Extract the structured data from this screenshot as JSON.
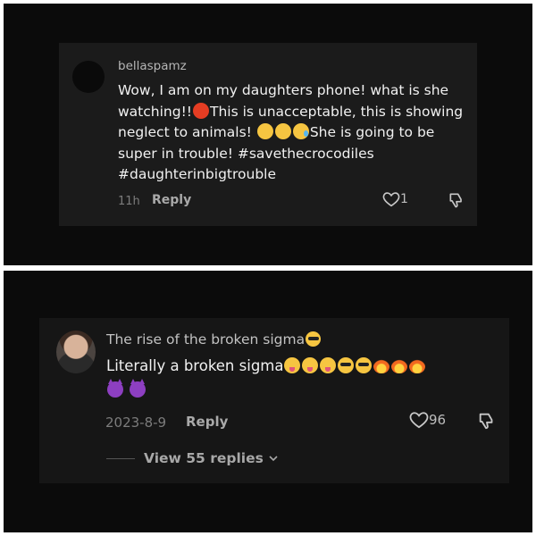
{
  "comments": [
    {
      "username": "bellaspamz",
      "text_parts": [
        "Wow, I am on my daughters phone! what is she watching!!",
        "This is unacceptable, this is showing neglect to animals!",
        "She is going to be super in trouble! #savethecrocodiles #daughterinbigtrouble"
      ],
      "emojis": [
        "angry-face",
        "disappointed-face",
        "confounded-face",
        "crying-face"
      ],
      "time": "11h",
      "reply_label": "Reply",
      "likes": "1"
    },
    {
      "username": "The rise of the broken sigma",
      "username_emoji": "sunglasses-face",
      "text": "Literally a broken sigma",
      "emojis": [
        "tongue-face",
        "tongue-face",
        "tongue-face",
        "sunglasses-face",
        "sunglasses-face",
        "fire",
        "fire",
        "fire",
        "smiling-devil",
        "smiling-devil"
      ],
      "time": "2023-8-9",
      "reply_label": "Reply",
      "likes": "96",
      "view_replies": "View 55 replies"
    }
  ]
}
